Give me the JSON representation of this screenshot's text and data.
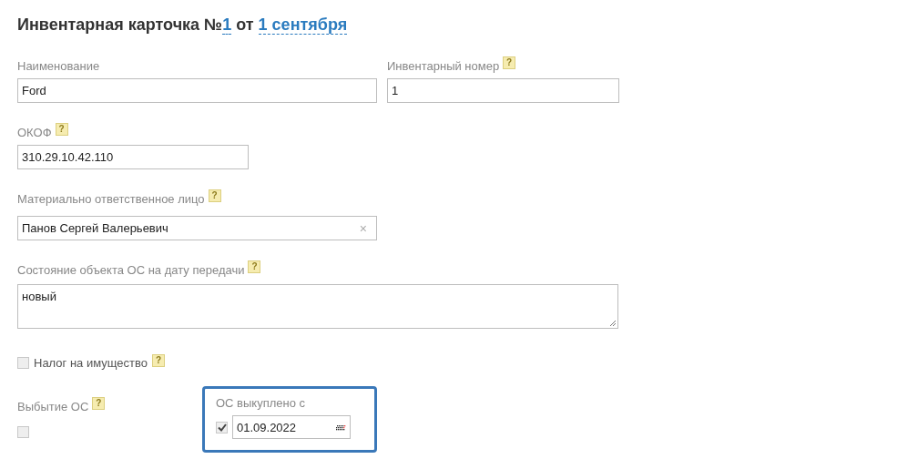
{
  "header": {
    "prefix": "Инвентарная карточка №",
    "number": "1",
    "between": "от",
    "date": "1 сентября"
  },
  "row_1": [
    {
      "label": "Наименование",
      "value": "Ford"
    },
    {
      "label": "Инвентарный номер",
      "help": "?",
      "value": "1"
    }
  ],
  "okof": {
    "label": "ОКОФ",
    "help": "?",
    "value": "310.29.10.42.110"
  },
  "responsible": {
    "label": "Материально ответственное лицо",
    "help": "?",
    "value": "Панов Сергей Валерьевич",
    "clear": "×"
  },
  "condition": {
    "label": "Состояние объекта ОС на дату передачи",
    "help": "?",
    "value": "новый"
  },
  "property_tax": {
    "label": "Налог на имущество",
    "help": "?",
    "checked": false
  },
  "disposal": {
    "label": "Выбытие ОС",
    "help": "?",
    "checked": false
  },
  "bought_out": {
    "label": "ОС выкуплено с",
    "checked": true,
    "date": "01.09.2022",
    "highlighted": true
  }
}
